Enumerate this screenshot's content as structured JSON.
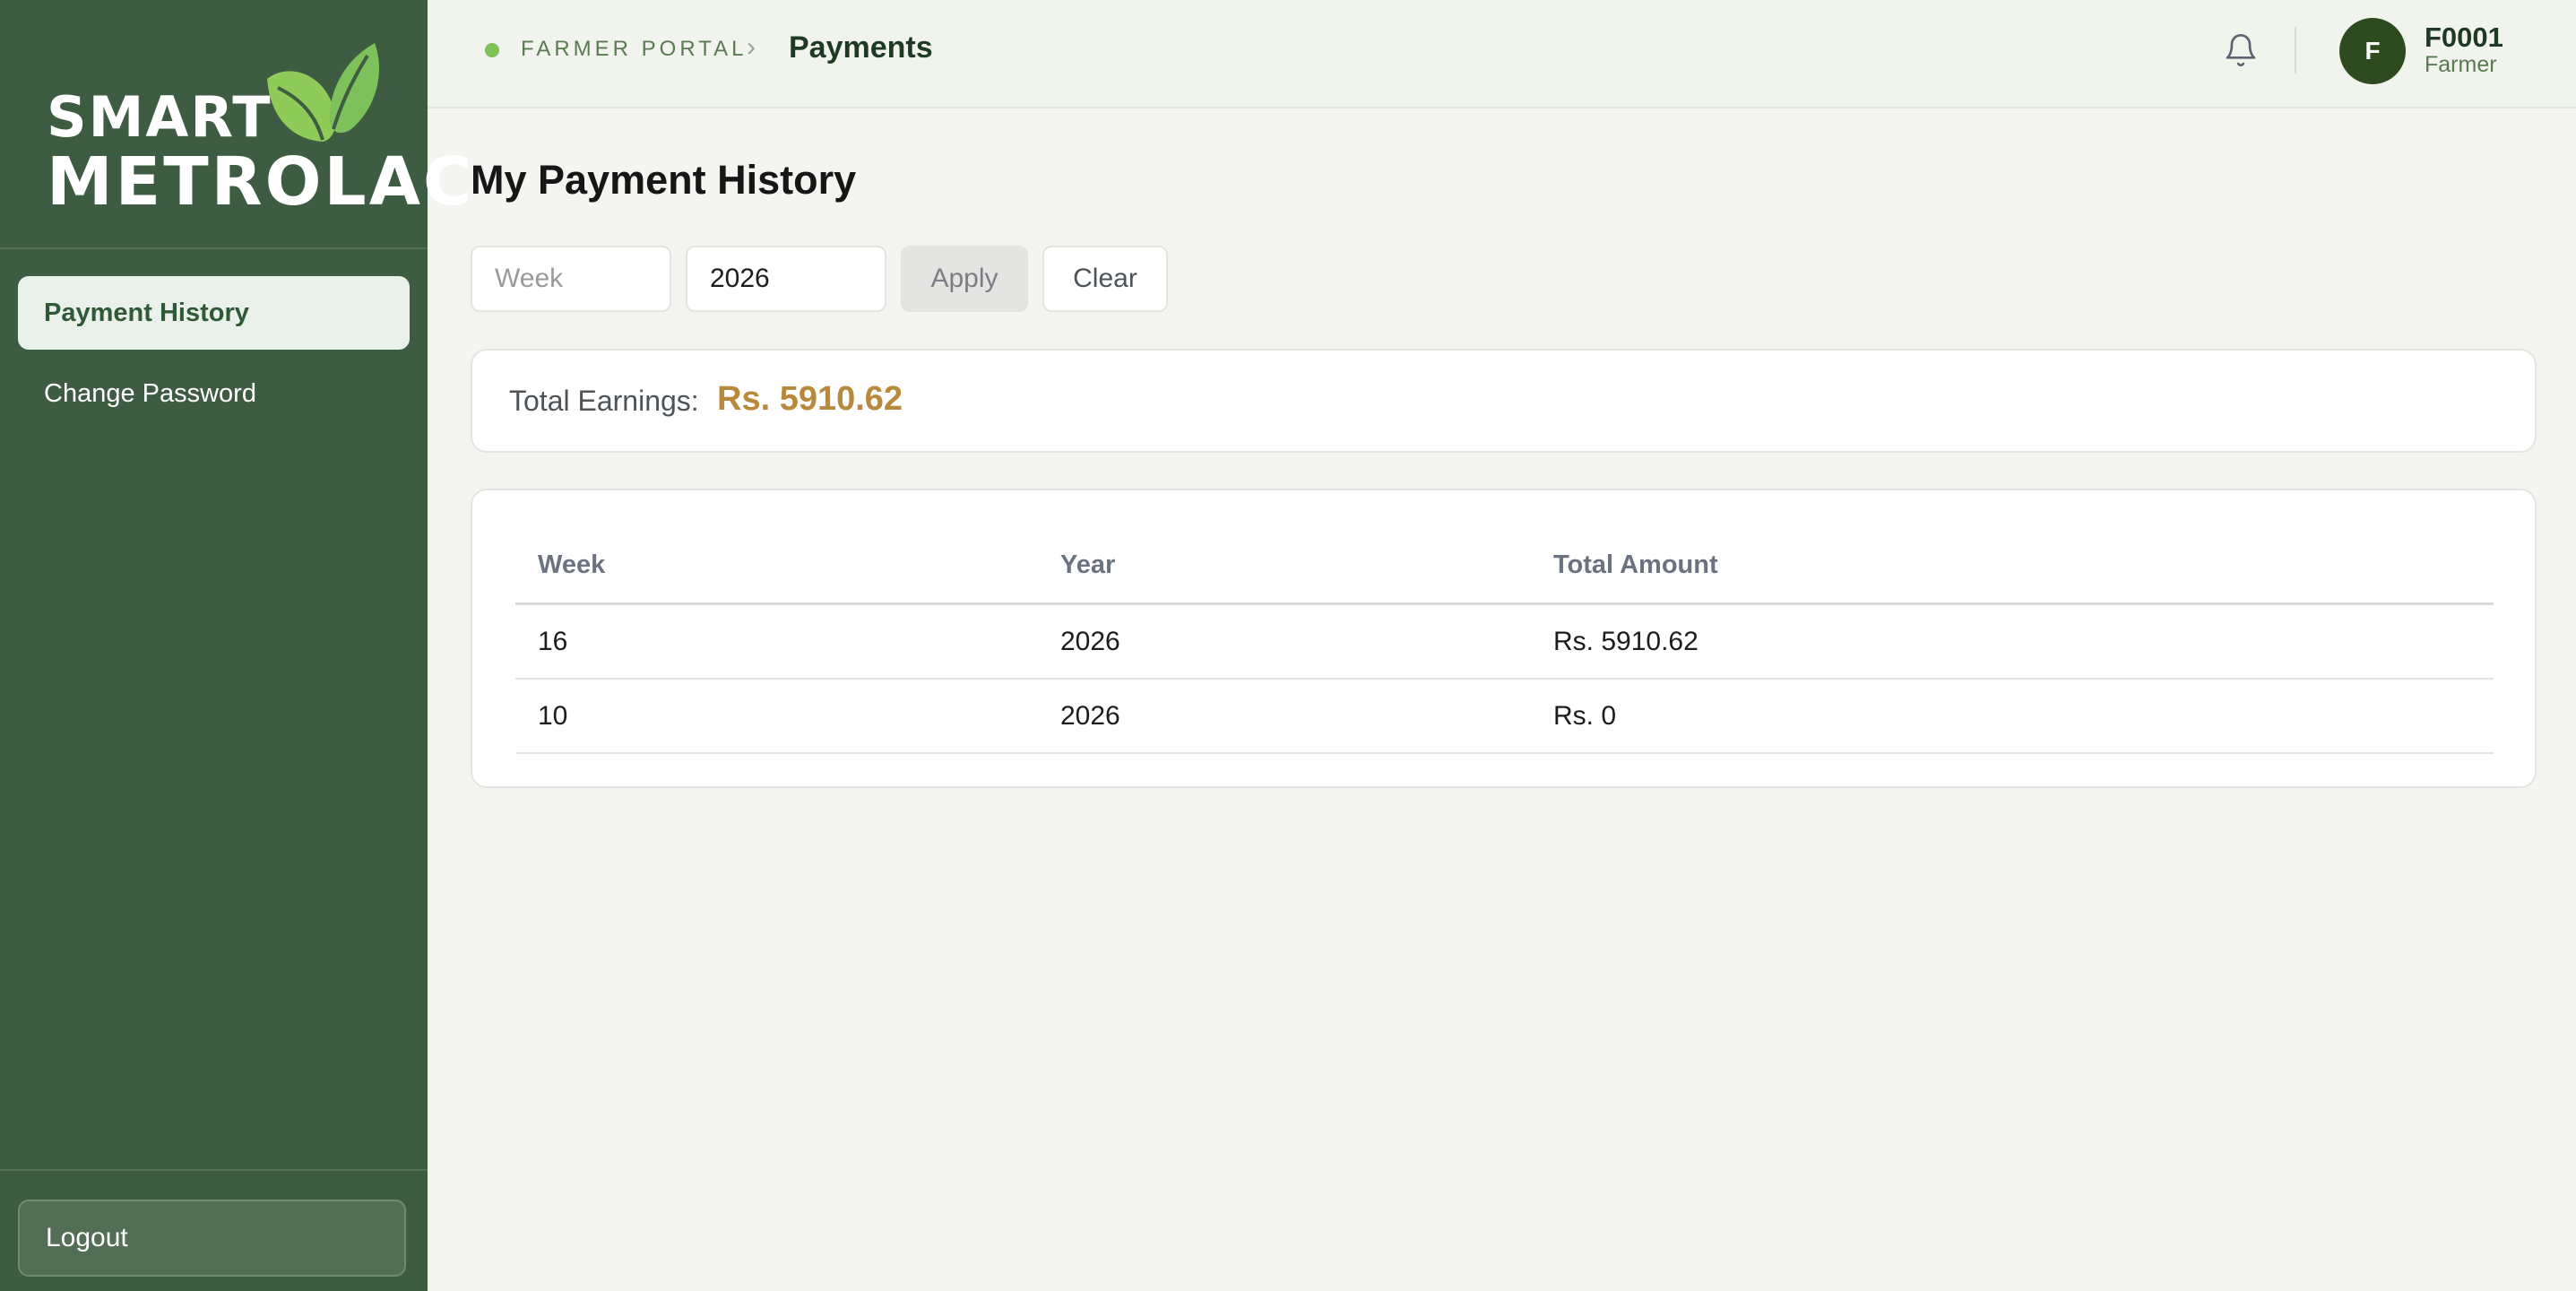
{
  "brand": {
    "line1": "SMART",
    "line2": "METROLAC",
    "leaf_color": "#7cc159"
  },
  "sidebar": {
    "items": [
      {
        "label": "Payment History",
        "active": true
      },
      {
        "label": "Change Password",
        "active": false
      }
    ],
    "logout_label": "Logout"
  },
  "header": {
    "portal_label": "FARMER PORTAL",
    "separator": "›",
    "page_label": "Payments",
    "bell_icon": "bell-icon",
    "user": {
      "initial": "F",
      "id": "F0001",
      "role": "Farmer"
    }
  },
  "main": {
    "title": "My Payment History",
    "filters": {
      "week_placeholder": "Week",
      "week_value": "",
      "year_value": "2026",
      "apply_label": "Apply",
      "clear_label": "Clear"
    },
    "earnings": {
      "label": "Total Earnings:",
      "value": "Rs. 5910.62"
    },
    "table": {
      "columns": [
        "Week",
        "Year",
        "Total Amount"
      ],
      "rows": [
        [
          "16",
          "2026",
          "Rs. 5910.62"
        ],
        [
          "10",
          "2026",
          "Rs. 0"
        ]
      ]
    }
  },
  "colors": {
    "sidebar_bg": "#3d5c42",
    "accent_gold": "#b8893a",
    "avatar_bg": "#2e4a1f"
  }
}
